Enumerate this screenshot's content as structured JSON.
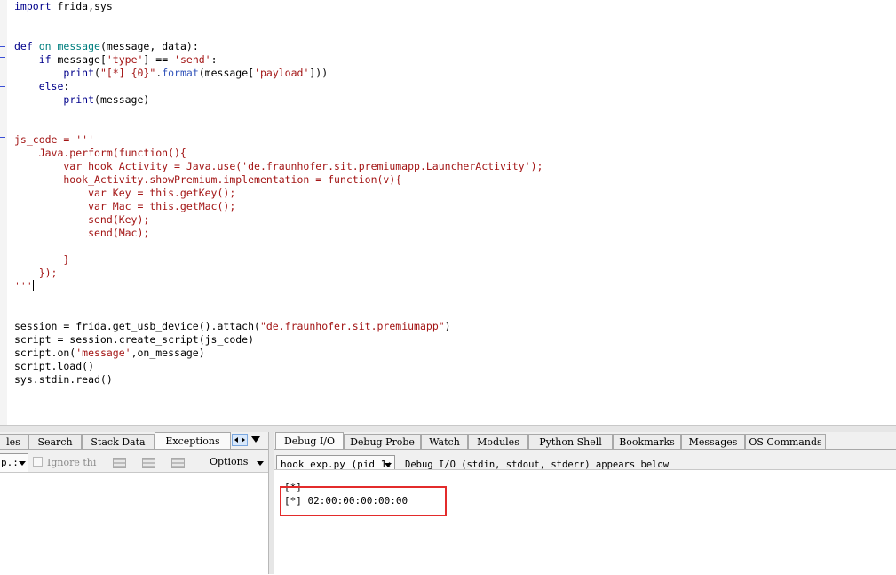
{
  "editor": {
    "lines": [
      "import frida,sys",
      "",
      "",
      "def on_message(message, data):",
      "    if message['type'] == 'send':",
      "        print(\"[*] {0}\".format(message['payload']))",
      "    else:",
      "        print(message)",
      "",
      "",
      "js_code = '''",
      "    Java.perform(function(){",
      "        var hook_Activity = Java.use('de.fraunhofer.sit.premiumapp.LauncherActivity');",
      "        hook_Activity.showPremium.implementation = function(v){",
      "            var Key = this.getKey();",
      "            var Mac = this.getMac();",
      "            send(Key);",
      "            send(Mac);",
      "",
      "        }",
      "    });",
      "'''",
      "",
      "",
      "session = frida.get_usb_device().attach(\"de.fraunhofer.sit.premiumapp\")",
      "script = session.create_script(js_code)",
      "script.on('message',on_message)",
      "script.load()",
      "sys.stdin.read()"
    ]
  },
  "left_panel": {
    "tabs": [
      "les",
      "Search",
      "Stack Data",
      "Exceptions"
    ],
    "active_tab": "Exceptions",
    "combo_value": "p.:",
    "ignore_label": "Ignore thi",
    "options_label": "Options"
  },
  "right_panel": {
    "tabs": [
      "Debug I/O",
      "Debug Probe",
      "Watch",
      "Modules",
      "Python Shell",
      "Bookmarks",
      "Messages",
      "OS Commands"
    ],
    "active_tab": "Debug I/O",
    "process_select": "hook_exp.py (pid 1:",
    "hint": "Debug I/O (stdin, stdout, stderr) appears below",
    "output": [
      "[*]",
      "[*] 02:00:00:00:00:00"
    ]
  },
  "colors": {
    "highlight": "#e32b2b",
    "keyword": "#00008b",
    "string": "#a31515"
  }
}
